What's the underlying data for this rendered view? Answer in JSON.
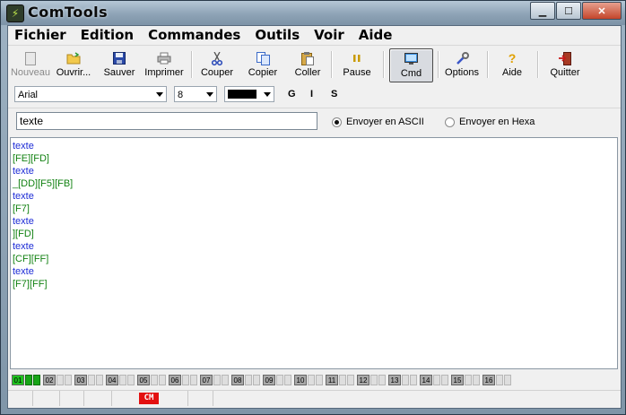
{
  "window": {
    "title": "ComTools"
  },
  "menu": [
    "Fichier",
    "Edition",
    "Commandes",
    "Outils",
    "Voir",
    "Aide"
  ],
  "toolbar": {
    "new_label": "Nouveau",
    "open_label": "Ouvrir...",
    "save_label": "Sauver",
    "print_label": "Imprimer",
    "cut_label": "Couper",
    "copy_label": "Copier",
    "paste_label": "Coller",
    "pause_label": "Pause",
    "cmd_label": "Cmd",
    "options_label": "Options",
    "help_label": "Aide",
    "quit_label": "Quitter"
  },
  "format": {
    "font": "Arial",
    "size": "8",
    "color": "#000000",
    "bold": "G",
    "italic": "I",
    "underline": "S"
  },
  "send": {
    "value": "texte",
    "ascii_label": "Envoyer en ASCII",
    "hexa_label": "Envoyer en Hexa",
    "selected": "ascii"
  },
  "terminal": {
    "lines": [
      {
        "text": "texte",
        "kind": "tx"
      },
      {
        "text": "[FE][FD]",
        "kind": "rx"
      },
      {
        "text": "texte",
        "kind": "tx"
      },
      {
        "text": "_[DD][F5][FB]",
        "kind": "rx"
      },
      {
        "text": "texte",
        "kind": "tx"
      },
      {
        "text": "[F7]",
        "kind": "rx"
      },
      {
        "text": "texte",
        "kind": "tx"
      },
      {
        "text": "][FD]",
        "kind": "rx"
      },
      {
        "text": "texte",
        "kind": "tx"
      },
      {
        "text": "[CF][FF]",
        "kind": "rx"
      },
      {
        "text": "texte",
        "kind": "tx"
      },
      {
        "text": "[F7][FF]",
        "kind": "rx"
      }
    ],
    "tx_color": "#1d2cd6",
    "rx_color": "#138213"
  },
  "channels": [
    "01",
    "02",
    "03",
    "04",
    "05",
    "06",
    "07",
    "08",
    "09",
    "10",
    "11",
    "12",
    "13",
    "14",
    "15",
    "16"
  ],
  "active_channel": "01",
  "status": {
    "cm_badge": "CM"
  }
}
